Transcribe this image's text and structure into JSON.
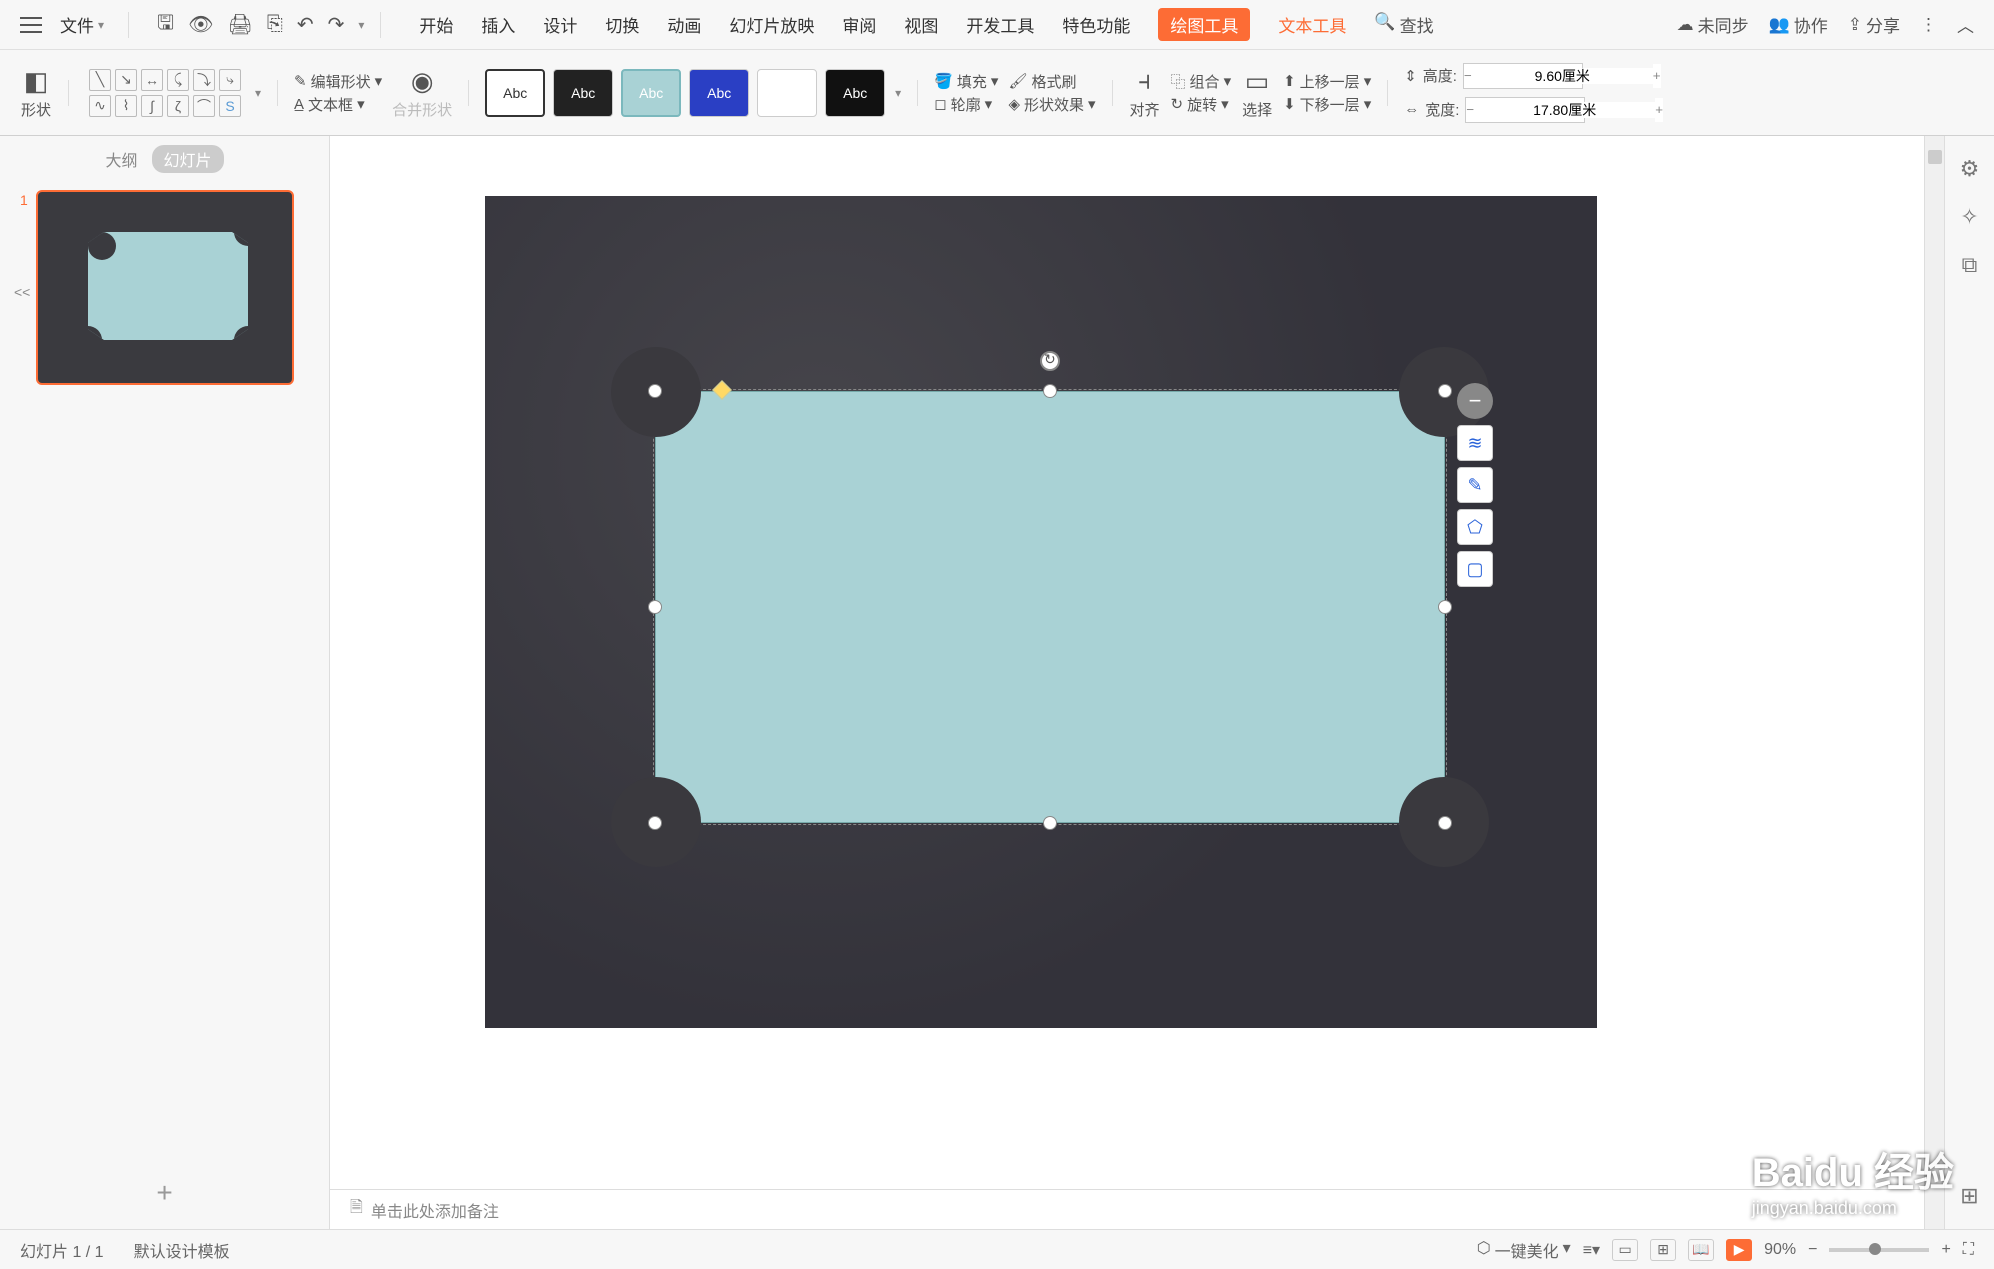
{
  "titlebar": {
    "file": "文件",
    "tabs": [
      "开始",
      "插入",
      "设计",
      "切换",
      "动画",
      "幻灯片放映",
      "审阅",
      "视图",
      "开发工具",
      "特色功能"
    ],
    "drawing_tools": "绘图工具",
    "text_tools": "文本工具",
    "search": "查找",
    "unsync": "未同步",
    "collab": "协作",
    "share": "分享"
  },
  "ribbon": {
    "shape_btn": "形状",
    "edit_shape": "编辑形状",
    "text_box": "文本框",
    "merge_shape": "合并形状",
    "style_label": "Abc",
    "fill": "填充",
    "format_painter": "格式刷",
    "outline": "轮廓",
    "shape_effect": "形状效果",
    "align": "对齐",
    "group": "组合",
    "rotate": "旋转",
    "select": "选择",
    "bring_fwd": "上移一层",
    "send_back": "下移一层",
    "height_lbl": "高度:",
    "width_lbl": "宽度:",
    "height_val": "9.60厘米",
    "width_val": "17.80厘米"
  },
  "side": {
    "outline": "大纲",
    "slides": "幻灯片",
    "collapse": "<<",
    "slide_num": "1"
  },
  "notes": "单击此处添加备注",
  "status": {
    "page": "幻灯片 1 / 1",
    "template": "默认设计模板",
    "beautify": "一键美化",
    "zoom": "90%"
  },
  "watermark": {
    "main": "Baidu 经验",
    "sub": "jingyan.baidu.com"
  }
}
